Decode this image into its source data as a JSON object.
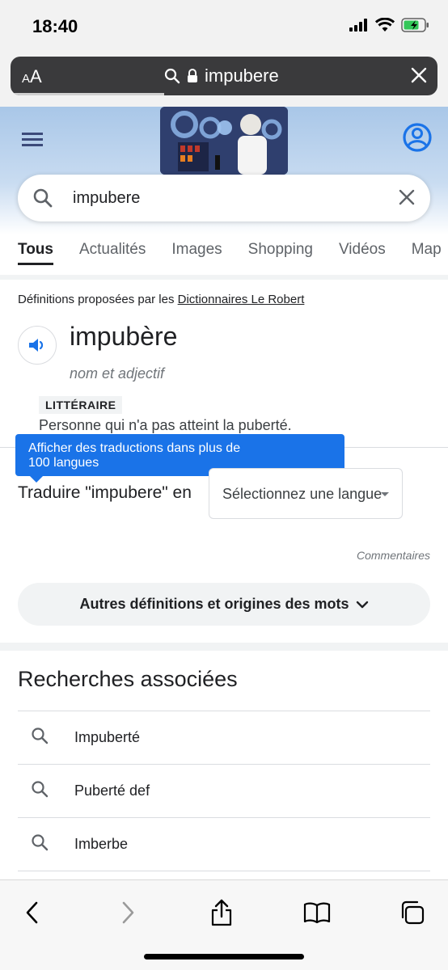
{
  "status": {
    "time": "18:40"
  },
  "browser": {
    "text_size_label": "AA",
    "url": "impubere",
    "progress": 0.36
  },
  "search": {
    "query": "impubere"
  },
  "tabs": [
    "Tous",
    "Actualités",
    "Images",
    "Shopping",
    "Vidéos",
    "Map"
  ],
  "dictionary": {
    "source_prefix": "Définitions proposées par les",
    "source_link": "Dictionnaires Le Robert",
    "word": "impubère",
    "part_of_speech": "nom et adjectif",
    "register": "LITTÉRAIRE",
    "definition": "Personne qui n'a pas atteint la puberté."
  },
  "translate": {
    "tooltip_line1": "Afficher des traductions dans plus de",
    "tooltip_line2": "100 langues",
    "label": "Traduire \"impubere\" en",
    "select_value": "Sélectionnez une langue"
  },
  "feedback": "Commentaires",
  "more_definitions": "Autres définitions et origines des mots",
  "related": {
    "title": "Recherches associées",
    "items": [
      "Impuberté",
      "Puberté def",
      "Imberbe"
    ]
  },
  "colors": {
    "google_blue": "#1a73e8",
    "header_bg": "#a9c7e8",
    "url_bar": "#3a3a3c"
  }
}
